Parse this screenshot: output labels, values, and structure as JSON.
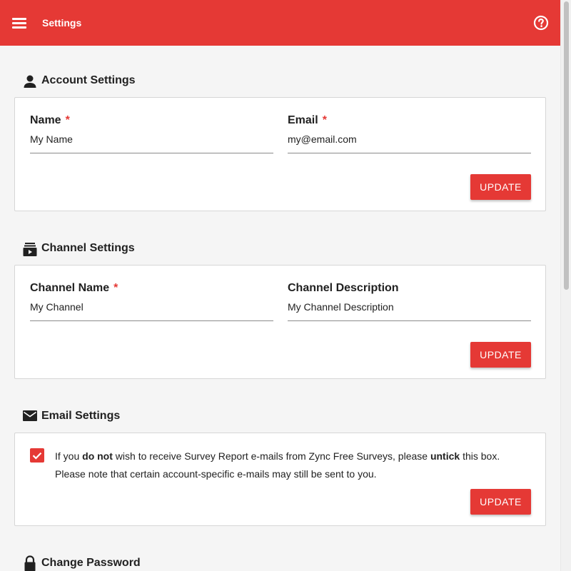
{
  "header": {
    "title": "Settings",
    "menu_icon": "hamburger-menu-icon",
    "help_icon": "help-circle-icon",
    "color": "#e53935"
  },
  "account": {
    "title": "Account Settings",
    "icon": "person-icon",
    "name_label": "Name",
    "name_value": "My Name",
    "email_label": "Email",
    "email_value": "my@email.com",
    "required_mark": "*",
    "button": "UPDATE"
  },
  "channel": {
    "title": "Channel Settings",
    "icon": "channel-video-icon",
    "name_label": "Channel Name",
    "name_value": "My Channel",
    "desc_label": "Channel Description",
    "desc_value": "My Channel Description",
    "required_mark": "*",
    "button": "UPDATE"
  },
  "email_settings": {
    "title": "Email Settings",
    "icon": "envelope-icon",
    "checked": true,
    "text_1": "If you ",
    "text_bold_1": "do not",
    "text_2": " wish to receive Survey Report e-mails from Zync Free Surveys, please ",
    "text_bold_2": "untick",
    "text_3": " this box.",
    "text_4": "Please note that certain account-specific e-mails may still be sent to you.",
    "button": "UPDATE"
  },
  "password": {
    "title": "Change Password",
    "icon": "lock-icon"
  }
}
